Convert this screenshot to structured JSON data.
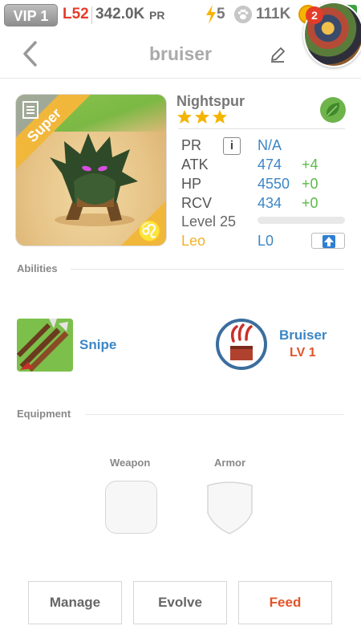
{
  "status_bar": {
    "vip": "VIP 1",
    "level": "L52",
    "pr_value": "342.0K",
    "pr_unit": "PR",
    "energy": "5",
    "paw_count": "111K",
    "notification_count": "2"
  },
  "header": {
    "title": "bruiser"
  },
  "creature": {
    "rarity": "Super",
    "name": "Nightspur",
    "stars": 3,
    "element": "leaf-icon",
    "stats": {
      "pr": {
        "label": "PR",
        "value": "N/A"
      },
      "atk": {
        "label": "ATK",
        "value": "474",
        "bonus": "+4"
      },
      "hp": {
        "label": "HP",
        "value": "4550",
        "bonus": "+0"
      },
      "rcv": {
        "label": "RCV",
        "value": "434",
        "bonus": "+0"
      }
    },
    "level": "Level 25",
    "xp_fraction": 0,
    "sign": "Leo",
    "sign_level": "L0",
    "zodiac_symbol": "♌"
  },
  "abilities": {
    "title": "Abilities",
    "items": [
      {
        "name": "Snipe"
      },
      {
        "name": "Bruiser",
        "level": "LV 1"
      }
    ]
  },
  "equipment": {
    "title": "Equipment",
    "weapon_label": "Weapon",
    "armor_label": "Armor"
  },
  "actions": {
    "manage": "Manage",
    "evolve": "Evolve",
    "feed": "Feed"
  },
  "colors": {
    "accent_blue": "#3b86c6",
    "bonus_green": "#5cba4a",
    "feed_orange": "#e0542a",
    "rarity_gold": "#f1b73b"
  }
}
